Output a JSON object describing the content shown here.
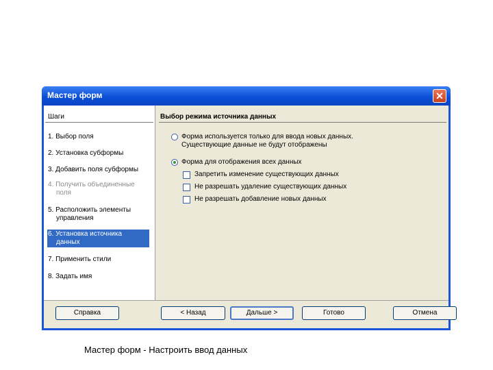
{
  "window": {
    "title": "Мастер форм",
    "close_glyph": "✕"
  },
  "steps": {
    "heading": "Шаги",
    "items": [
      {
        "line1": "1. Выбор поля",
        "line2": ""
      },
      {
        "line1": "2. Установка субформы",
        "line2": ""
      },
      {
        "line1": "3. Добавить поля субформы",
        "line2": ""
      },
      {
        "line1": "4. Получить объединенные",
        "line2": "поля"
      },
      {
        "line1": "5. Расположить элементы",
        "line2": "управления"
      },
      {
        "line1": "6. Установка источника",
        "line2": "данных"
      },
      {
        "line1": "7. Применить стили",
        "line2": ""
      },
      {
        "line1": "8. Задать имя",
        "line2": ""
      }
    ]
  },
  "content": {
    "heading": "Выбор режима источника данных",
    "radio1": {
      "line1": "Форма используется только для ввода новых данных.",
      "line2": "Существующие данные не будут отображены",
      "checked": false
    },
    "radio2": {
      "label": "Форма для отображения всех данных",
      "checked": true
    },
    "checkboxes": [
      {
        "label": "Запретить изменение существующих данных",
        "checked": false
      },
      {
        "label": "Не разрешать удаление существующих данных",
        "checked": false
      },
      {
        "label": "Не разрешать добавление новых данных",
        "checked": false
      }
    ]
  },
  "buttons": {
    "help": "Справка",
    "back": "< Назад",
    "next": "Дальше >",
    "finish": "Готово",
    "cancel": "Отмена"
  },
  "caption": "Мастер форм - Настроить ввод данных"
}
